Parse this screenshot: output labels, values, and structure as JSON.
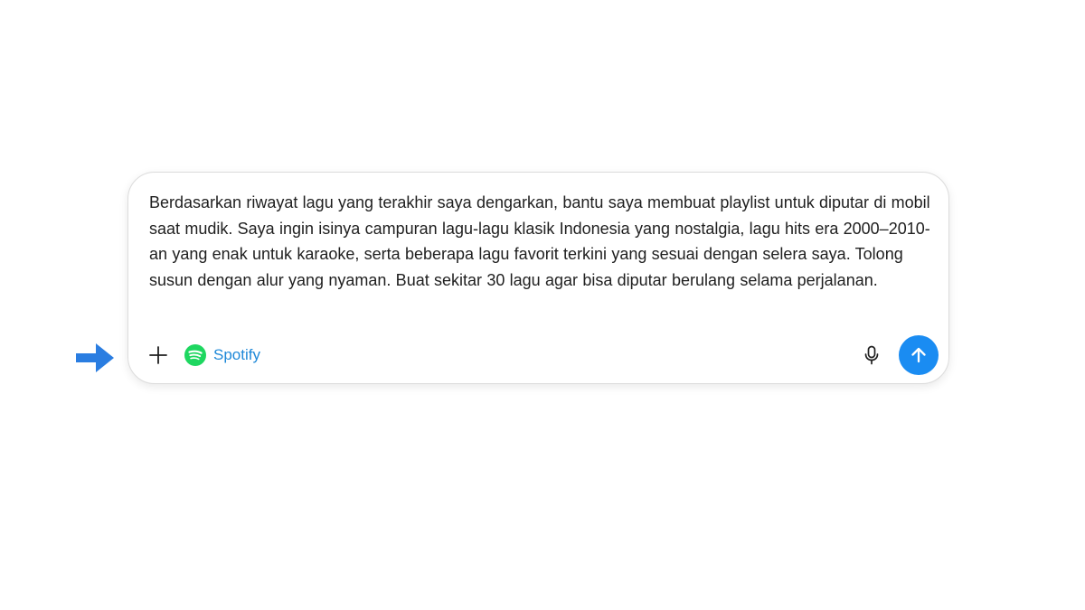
{
  "composer": {
    "prompt_text": "Berdasarkan riwayat lagu yang terakhir saya dengarkan, bantu saya membuat playlist untuk diputar di mobil saat mudik. Saya ingin isinya campuran lagu-lagu klasik Indonesia yang nostalgia, lagu hits era 2000–2010-an yang enak untuk karaoke, serta beberapa lagu favorit terkini yang sesuai dengan selera saya. Tolong susun dengan alur yang nyaman. Buat sekitar 30 lagu agar bisa diputar berulang selama perjalanan.",
    "connector_label": "Spotify"
  },
  "icons": {
    "pointer": "arrow-right-icon",
    "add": "plus-icon",
    "connector": "spotify-icon",
    "voice": "microphone-icon",
    "send": "arrow-up-icon"
  },
  "colors": {
    "accent_blue": "#1a8cf2",
    "connector_text": "#1e88d8",
    "spotify_green": "#1ed760",
    "pointer_arrow": "#2a7de1"
  }
}
